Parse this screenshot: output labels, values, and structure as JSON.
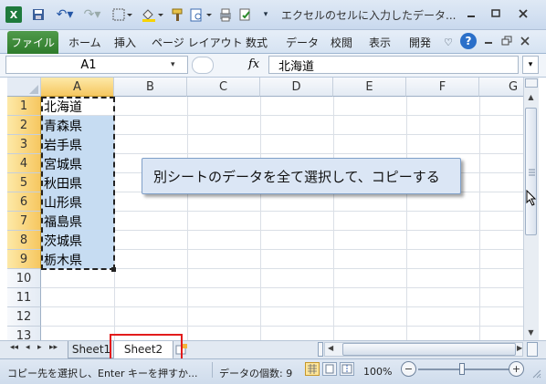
{
  "window": {
    "title": "エクセルのセルに入力したデータ..."
  },
  "ribbon": {
    "file_tab": "ファイル",
    "tabs": [
      "ホーム",
      "挿入",
      "ページ レイアウト",
      "数式",
      "データ",
      "校閲",
      "表示",
      "開発"
    ]
  },
  "formula_bar": {
    "name_box": "A1",
    "fx_label": "fx",
    "formula": "北海道"
  },
  "grid": {
    "columns": [
      "A",
      "B",
      "C",
      "D",
      "E",
      "F",
      "G"
    ],
    "rows": [
      "1",
      "2",
      "3",
      "4",
      "5",
      "6",
      "7",
      "8",
      "9",
      "10",
      "11",
      "12",
      "13"
    ],
    "column_a_values": [
      "北海道",
      "青森県",
      "岩手県",
      "宮城県",
      "秋田県",
      "山形県",
      "福島県",
      "茨城県",
      "栃木県"
    ]
  },
  "callout": {
    "text": "別シートのデータを全て選択して、コピーする"
  },
  "sheet_tabs": {
    "tabs": [
      "Sheet1",
      "Sheet2"
    ],
    "active": "Sheet2"
  },
  "status_bar": {
    "message": "コピー先を選択し、Enter キーを押すか...",
    "count": "データの個数: 9",
    "zoom": "100%"
  },
  "colors": {
    "selection_fill": "#c6dcf2",
    "header_highlight": "#f6c760",
    "file_tab": "#2f7c2c",
    "annotation_box": "#e21b1b"
  }
}
